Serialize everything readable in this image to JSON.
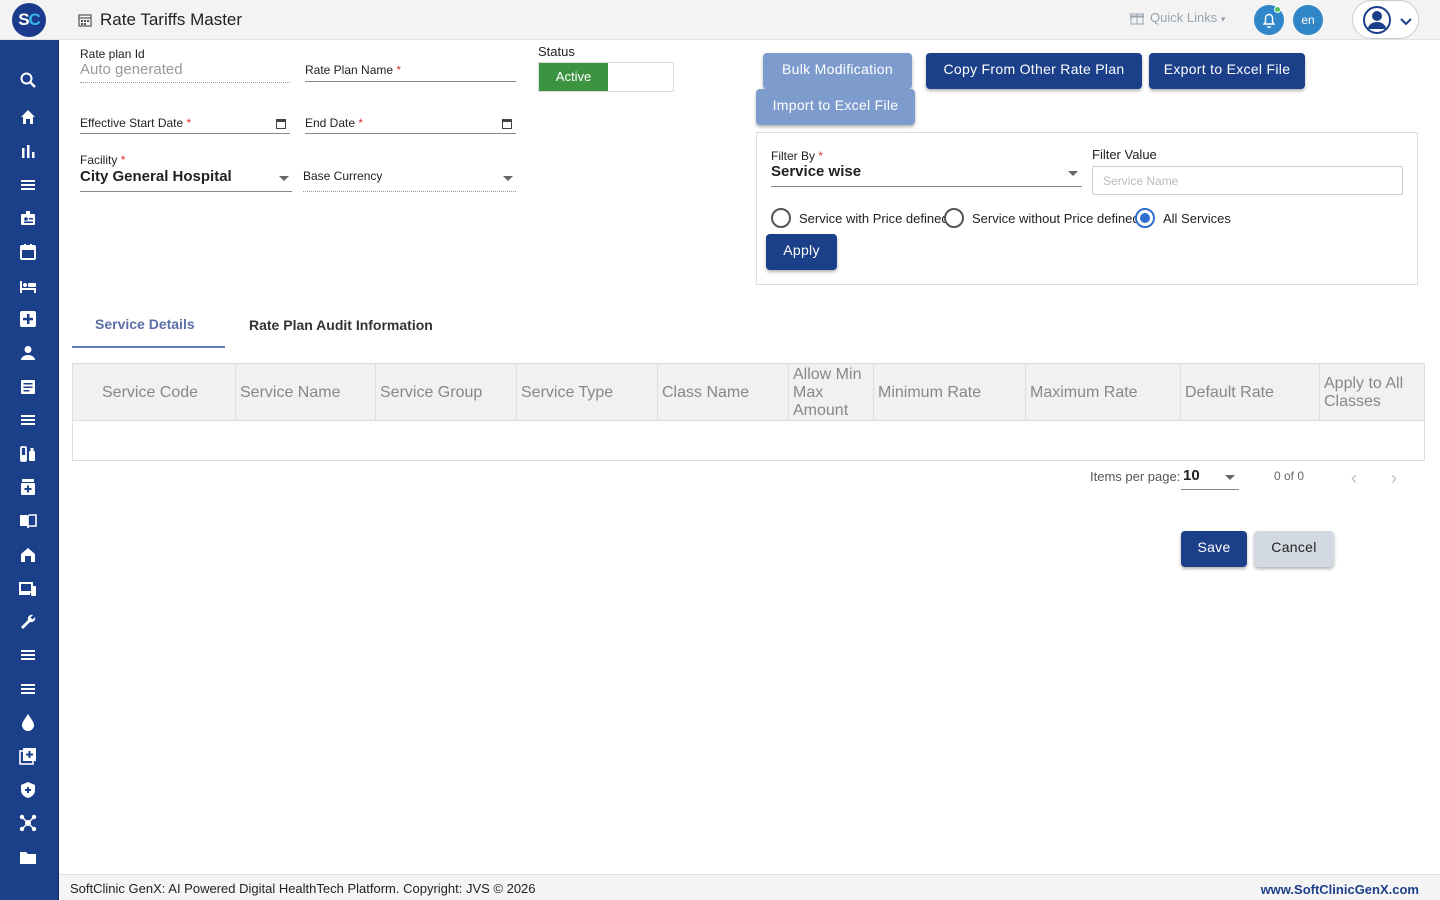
{
  "header": {
    "logo": {
      "s": "S",
      "c": "C"
    },
    "title": "Rate Tariffs Master",
    "quick_links": "Quick Links",
    "lang": "en"
  },
  "sidebar": {
    "icons": [
      "search-icon",
      "home-icon",
      "bar-chart-icon",
      "menu-icon",
      "id-badge-icon",
      "calendar-icon",
      "bed-icon",
      "medical-plus-icon",
      "person-icon",
      "document-icon",
      "menu-icon",
      "lab-icon",
      "medicine-icon",
      "book-icon",
      "building-icon",
      "devices-icon",
      "wrench-icon",
      "menu-icon",
      "menu-icon",
      "drop-icon",
      "add-box-icon",
      "shield-icon",
      "network-icon",
      "folder-icon"
    ]
  },
  "form": {
    "rate_plan_id_label": "Rate plan Id",
    "rate_plan_id_value": "Auto generated",
    "rate_plan_name_label": "Rate Plan Name",
    "status_label": "Status",
    "status_value": "Active",
    "effective_start_label": "Effective Start Date",
    "end_date_label": "End Date",
    "facility_label": "Facility",
    "facility_value": "City General Hospital",
    "base_currency_label": "Base Currency",
    "required_mark": "*"
  },
  "actions": {
    "bulk": "Bulk Modification",
    "copy": "Copy From Other Rate Plan",
    "export": "Export to Excel File",
    "import": "Import to Excel File"
  },
  "filter": {
    "filter_by_label": "Filter By",
    "filter_by_value": "Service wise",
    "filter_value_label": "Filter Value",
    "filter_value_placeholder": "Service Name",
    "radio_1": "Service with Price defined",
    "radio_2": "Service without Price defined",
    "radio_3": "All Services",
    "selected_radio": "All Services",
    "apply": "Apply"
  },
  "tabs": {
    "service_details": "Service Details",
    "audit": "Rate Plan Audit Information"
  },
  "table": {
    "columns": [
      "Service Code",
      "Service Name",
      "Service Group",
      "Service Type",
      "Class Name",
      "Allow Min Max Amount",
      "Minimum Rate",
      "Maximum Rate",
      "Default Rate",
      "Apply to All Classes"
    ],
    "rows": []
  },
  "pager": {
    "items_per_page_label": "Items per page:",
    "items_per_page": "10",
    "range": "0 of 0"
  },
  "buttons": {
    "save": "Save",
    "cancel": "Cancel"
  },
  "footer": {
    "left": "SoftClinic GenX: AI Powered Digital HealthTech Platform. Copyright: JVS © 2026",
    "right": "www.SoftClinicGenX.com"
  },
  "colors": {
    "brand": "#1c3f8a",
    "active_green": "#3d9440",
    "accent_blue": "#2f86c8"
  }
}
